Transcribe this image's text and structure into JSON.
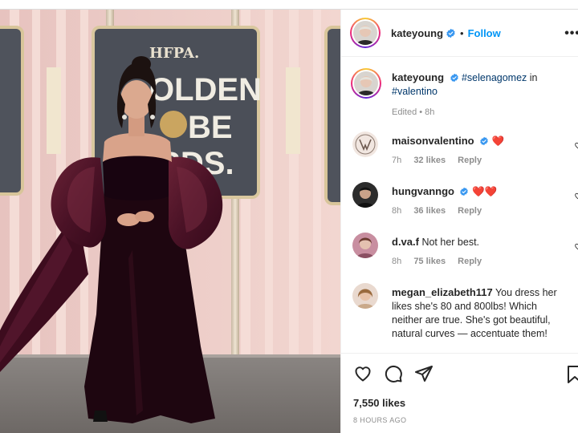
{
  "post": {
    "author": "kateyoung",
    "follow_label": "Follow",
    "separator": "•",
    "more_label": "•••",
    "sign_text": [
      "HFPA.",
      "OLDEN",
      "BE",
      "RDS."
    ]
  },
  "caption": {
    "author": "kateyoung",
    "mention": "#selenagomez",
    "text_in": " in",
    "hashtag": "#valentino",
    "edited": "Edited • 8h"
  },
  "comments": [
    {
      "user": "maisonvalentino",
      "verified": true,
      "text": "❤️",
      "time": "7h",
      "likes": "32 likes",
      "reply": "Reply",
      "avatar": "valentino-logo"
    },
    {
      "user": "hungvanngo",
      "verified": true,
      "text": "❤️❤️",
      "time": "8h",
      "likes": "36 likes",
      "reply": "Reply",
      "avatar": "hungvanngo-avatar"
    },
    {
      "user": "d.va.f",
      "verified": false,
      "text": "Not her best.",
      "time": "8h",
      "likes": "75 likes",
      "reply": "Reply",
      "avatar": "dvaf-avatar"
    },
    {
      "user": "megan_elizabeth117",
      "verified": false,
      "text": "You dress her likes she's 80 and 800lbs! Which neither are true. She's got beautiful, natural curves — accentuate them!",
      "time": "",
      "likes": "",
      "reply": "",
      "avatar": "megan-avatar"
    }
  ],
  "footer": {
    "likes": "7,550 likes",
    "time": "8 HOURS AGO"
  },
  "colors": {
    "accent": "#0095f6",
    "verified": "#3897f0",
    "heart": "#ed4956",
    "hashtag": "#00376b",
    "meta": "#8e8e8e"
  },
  "icons": [
    "heart-icon",
    "comment-icon",
    "share-icon",
    "bookmark-icon",
    "verified-badge-icon",
    "more-icon"
  ]
}
